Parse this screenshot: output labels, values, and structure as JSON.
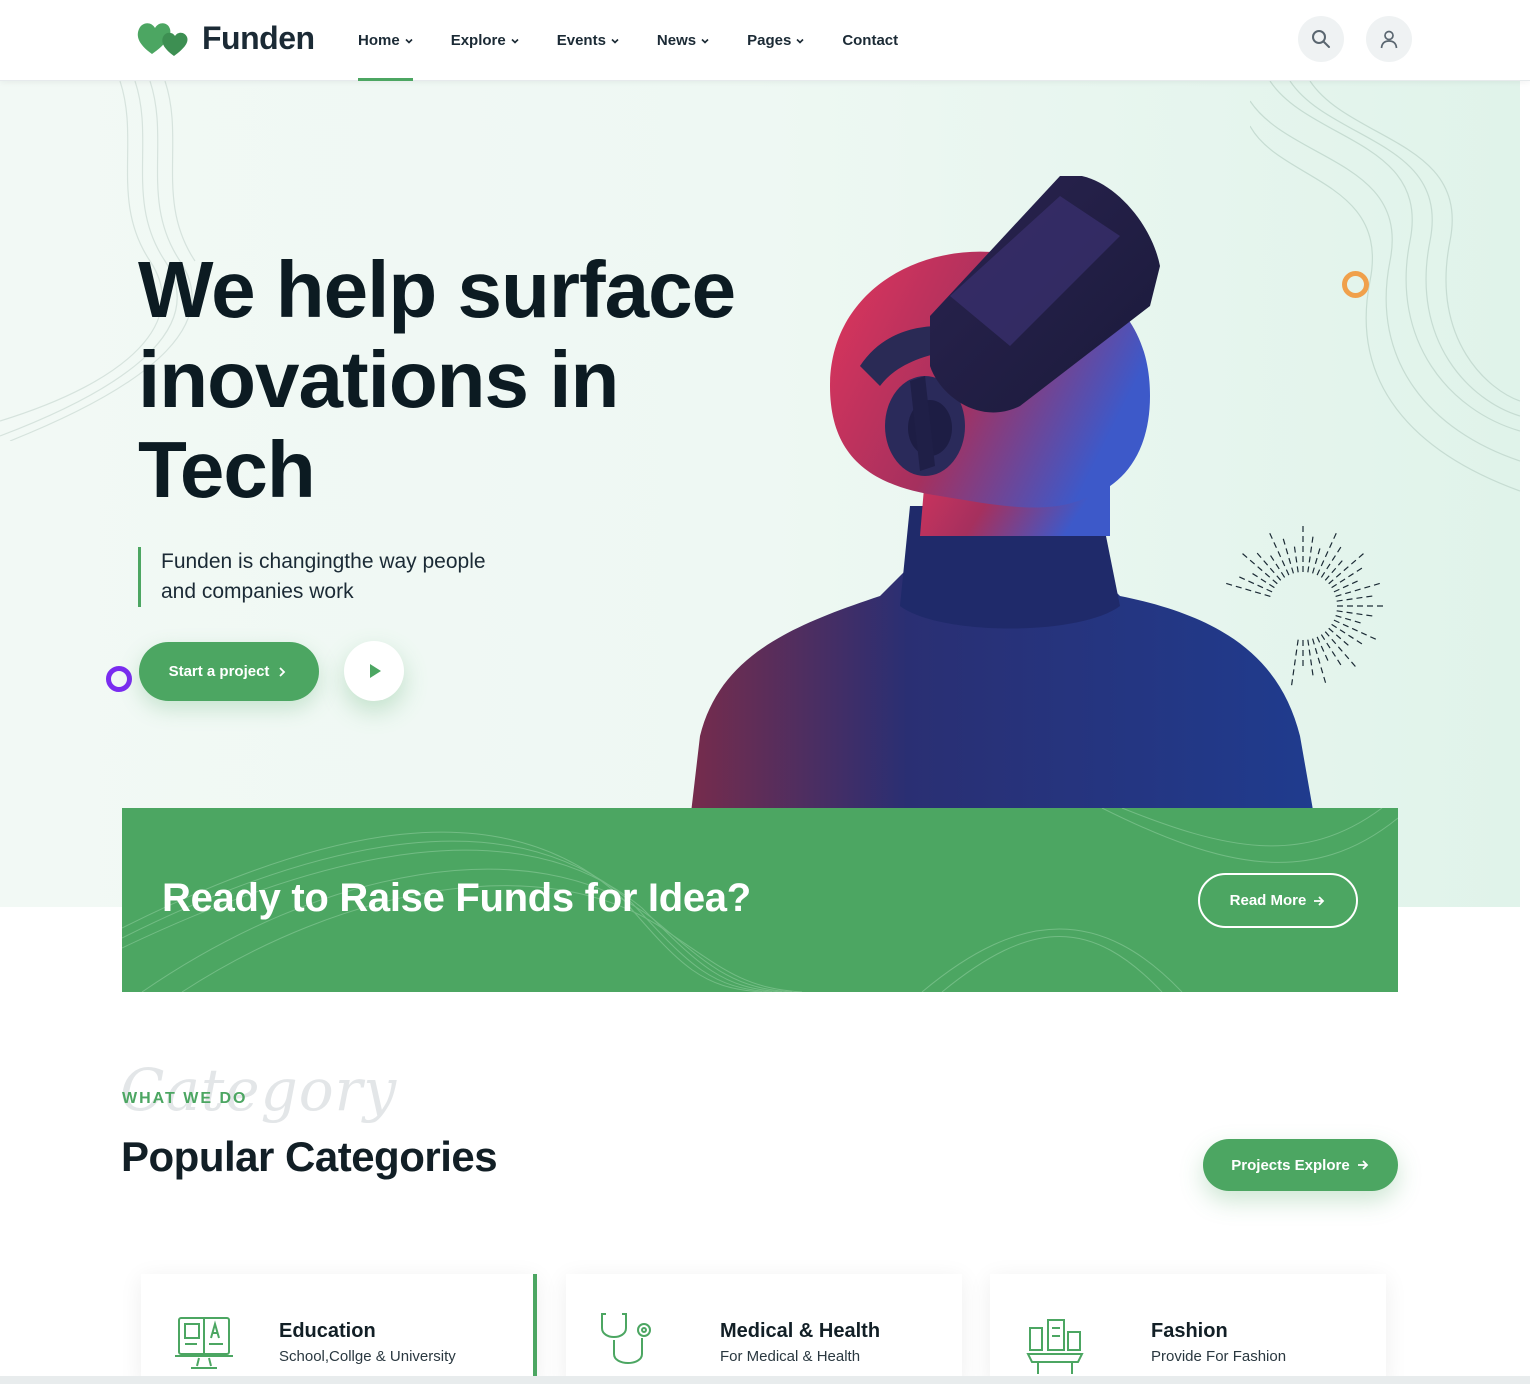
{
  "brand": {
    "name": "Funden",
    "accent": "#4ca662"
  },
  "nav": {
    "items": [
      {
        "label": "Home",
        "has_dropdown": true,
        "active": true
      },
      {
        "label": "Explore",
        "has_dropdown": true
      },
      {
        "label": "Events",
        "has_dropdown": true
      },
      {
        "label": "News",
        "has_dropdown": true
      },
      {
        "label": "Pages",
        "has_dropdown": true
      },
      {
        "label": "Contact",
        "has_dropdown": false
      }
    ],
    "search_icon": "search-icon",
    "user_icon": "user-icon"
  },
  "hero": {
    "title_line1": "We help surface",
    "title_line2": "inovations in",
    "title_line3": "Tech",
    "subtitle_line1": "Funden is changingthe way people",
    "subtitle_line2": "and companies work",
    "start_label": "Start a project",
    "play_icon": "play-icon"
  },
  "banner": {
    "title": "Ready to Raise Funds for Idea?",
    "button_label": "Read More"
  },
  "categories": {
    "script_bg": "Category",
    "eyebrow": "WHAT WE DO",
    "title": "Popular Categories",
    "explore_label": "Projects Explore",
    "cards": [
      {
        "title": "Education",
        "desc": "School,Collge & University",
        "icon": "education-icon"
      },
      {
        "title": "Medical & Health",
        "desc": "For Medical & Health",
        "icon": "stethoscope-icon"
      },
      {
        "title": "Fashion",
        "desc": "Provide For Fashion",
        "icon": "fashion-icon"
      }
    ]
  }
}
